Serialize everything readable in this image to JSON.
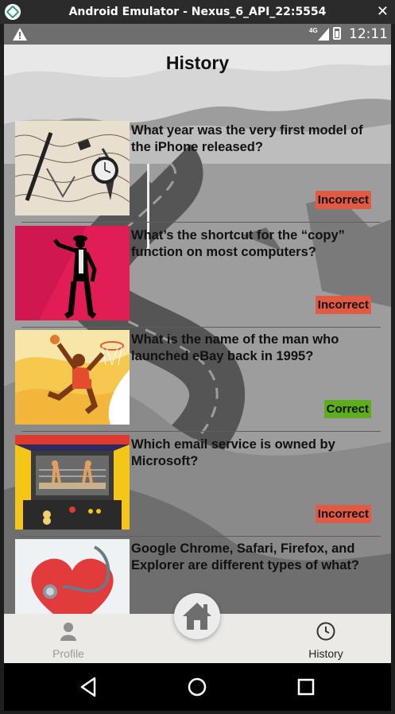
{
  "window": {
    "title": "Android Emulator - Nexus_6_API_22:5554",
    "close_glyph": "✕"
  },
  "status_bar": {
    "network": "4G",
    "time": "12:11"
  },
  "page": {
    "title": "History"
  },
  "history": [
    {
      "question": "What year was the very first model of the iPhone released?",
      "result": "Incorrect",
      "status": "incorrect",
      "image": "map-pens-illustration"
    },
    {
      "question": "What’s the shortcut for the “copy” function on most computers?",
      "result": "Incorrect",
      "status": "incorrect",
      "image": "dancer-silhouette"
    },
    {
      "question": "What is the name of the man who launched eBay back in 1995?",
      "result": "Correct",
      "status": "correct",
      "image": "basketball-dunk-illustration"
    },
    {
      "question": "Which email service is owned by Microsoft?",
      "result": "Incorrect",
      "status": "incorrect",
      "image": "arcade-boxing-kangaroos"
    },
    {
      "question": "Google Chrome, Safari, Firefox, and Explorer are different types of what?",
      "result": "",
      "status": "correct",
      "image": "heart-stethoscope"
    }
  ],
  "bottom_nav": {
    "profile_label": "Profile",
    "history_label": "History",
    "home_icon": "home-icon"
  },
  "colors": {
    "incorrect": "#e05a44",
    "correct": "#5dad1c"
  }
}
